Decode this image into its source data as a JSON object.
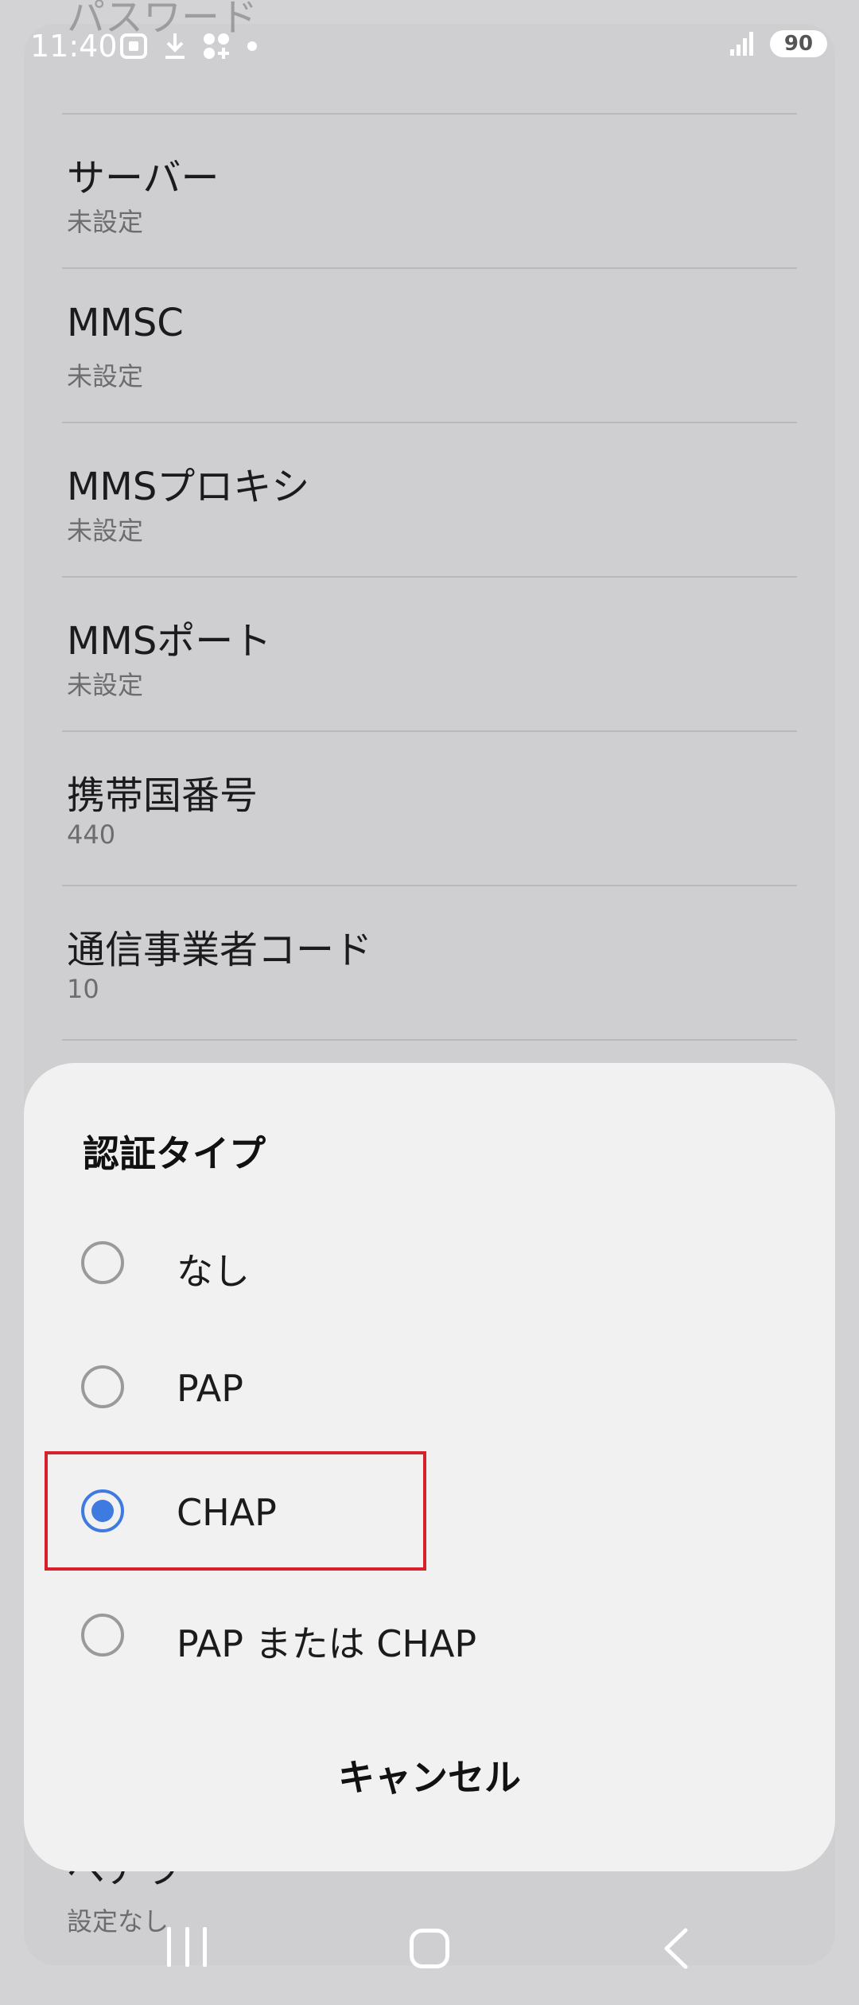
{
  "status_bar": {
    "time": "11:40",
    "battery": "90"
  },
  "background": {
    "partial_top": "パスワード",
    "rows": [
      {
        "title": "サーバー",
        "sub": "未設定"
      },
      {
        "title": "MMSC",
        "sub": "未設定"
      },
      {
        "title": "MMSプロキシ",
        "sub": "未設定"
      },
      {
        "title": "MMSポート",
        "sub": "未設定"
      },
      {
        "title": "携帯国番号",
        "sub": "440"
      },
      {
        "title": "通信事業者コード",
        "sub": "10"
      }
    ],
    "below_title": "ベアラ",
    "below_sub": "設定なし"
  },
  "dialog": {
    "title": "認証タイプ",
    "options": [
      {
        "label": "なし",
        "checked": false
      },
      {
        "label": "PAP",
        "checked": false
      },
      {
        "label": "CHAP",
        "checked": true
      },
      {
        "label": "PAP または CHAP",
        "checked": false
      }
    ],
    "cancel": "キャンセル"
  },
  "colors": {
    "accent": "#3f7ae0",
    "highlight": "#d6202a"
  },
  "icons": {
    "status_left": [
      "screenshot-icon",
      "download-icon",
      "apps-icon",
      "dot-icon"
    ],
    "status_right": [
      "signal-icon",
      "battery-icon"
    ],
    "nav": [
      "recents-icon",
      "home-icon",
      "back-icon"
    ]
  }
}
